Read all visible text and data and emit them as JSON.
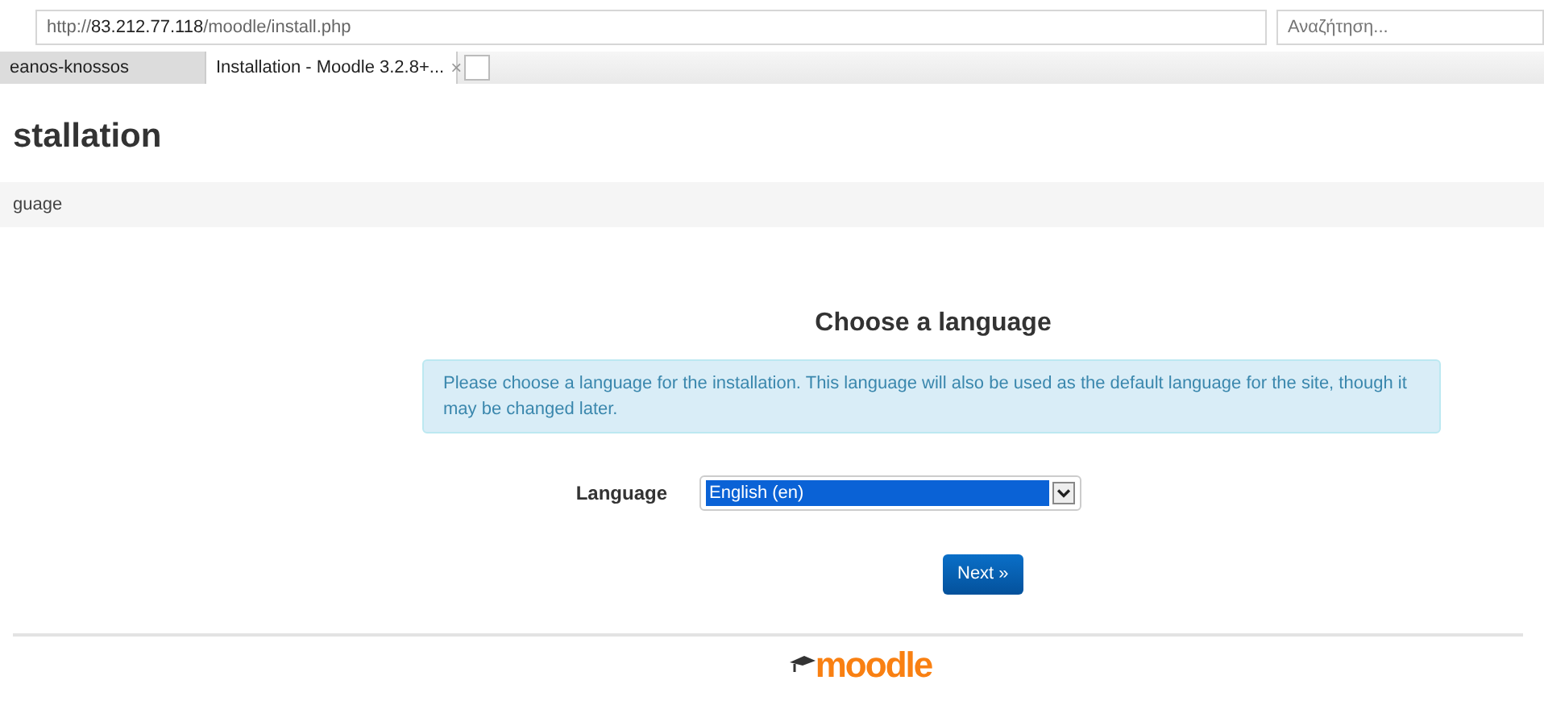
{
  "browser": {
    "url_prefix": "http://",
    "url_host": "83.212.77.118",
    "url_path": "/moodle/install.php",
    "search_placeholder": "Αναζήτηση...",
    "tabs": [
      {
        "label": "eanos-knossos",
        "selected": false,
        "closable": false
      },
      {
        "label": "Installation - Moodle 3.2.8+...",
        "selected": true,
        "closable": true
      }
    ],
    "close_glyph": "×"
  },
  "page": {
    "heading": "stallation",
    "breadcrumb": "guage",
    "title": "Choose a language",
    "alert": "Please choose a language for the installation. This language will also be used as the default language for the site, though it may be changed later.",
    "field_label": "Language",
    "field_value": "English (en)",
    "button": "Next »",
    "logo": "moodle"
  }
}
